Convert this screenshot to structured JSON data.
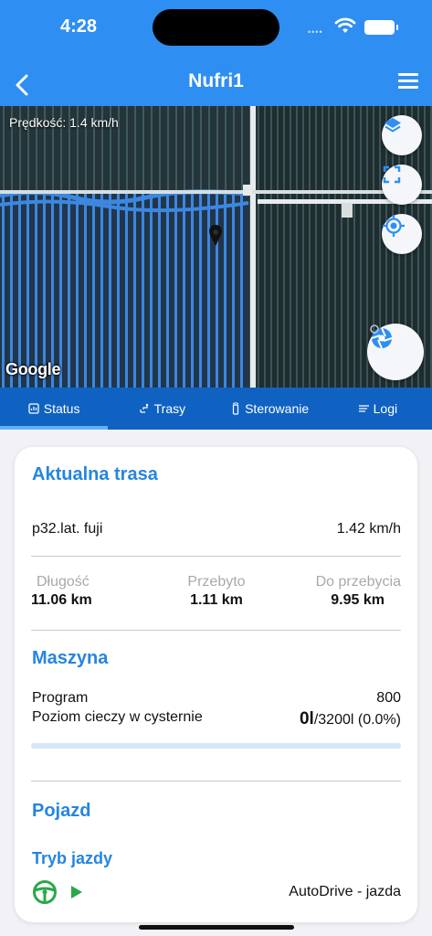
{
  "status_bar": {
    "time": "4:28"
  },
  "nav": {
    "title": "Nufri1"
  },
  "map": {
    "speed_text": "Prędkość: 1.4 km/h",
    "attribution": "Google"
  },
  "tabs": [
    {
      "label": "Status",
      "icon": "status-icon",
      "active": true
    },
    {
      "label": "Trasy",
      "icon": "route-icon",
      "active": false
    },
    {
      "label": "Sterowanie",
      "icon": "remote-icon",
      "active": false
    },
    {
      "label": "Logi",
      "icon": "list-icon",
      "active": false
    }
  ],
  "route": {
    "title": "Aktualna trasa",
    "name": "p32.lat. fuji",
    "speed": "1.42 km/h",
    "length_label": "Długość",
    "length_value": "11.06 km",
    "done_label": "Przebyto",
    "done_value": "1.11 km",
    "remaining_label": "Do przebycia",
    "remaining_value": "9.95 km"
  },
  "machine": {
    "title": "Maszyna",
    "program_label": "Program",
    "program_value": "800",
    "tank_label": "Poziom cieczy w cysternie",
    "tank_current": "0l",
    "tank_rest": "/3200l (0.0%)",
    "tank_fill_fraction": 0.0
  },
  "vehicle": {
    "title": "Pojazd",
    "mode_title": "Tryb jazdy",
    "mode_value": "AutoDrive - jazda"
  },
  "colors": {
    "primary": "#2f8ef2",
    "tab_bar": "#0f62c2",
    "accent_text": "#2585e0",
    "drive_green": "#2aa84a"
  }
}
